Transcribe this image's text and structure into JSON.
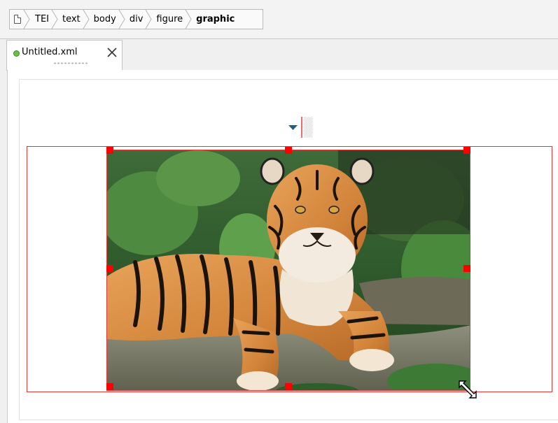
{
  "breadcrumb": {
    "items": [
      "TEI",
      "text",
      "body",
      "div",
      "figure",
      "graphic"
    ],
    "current": "graphic"
  },
  "tabs": [
    {
      "label": "Untitled.xml",
      "status_color": "#6dbf3f"
    }
  ],
  "icons": {
    "document": "file-icon",
    "tab_close": "close-icon",
    "tag_marker": "expand-triangle-icon",
    "resize": "resize-diagonal-icon"
  },
  "colors": {
    "selection": "#e23a3a",
    "handle": "#ff0000",
    "marker_triangle": "#1f5f7a"
  }
}
